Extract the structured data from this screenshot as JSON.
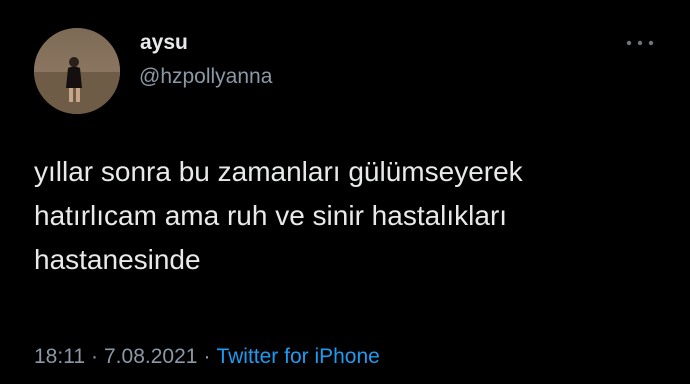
{
  "user": {
    "display_name": "aysu",
    "handle": "@hzpollyanna"
  },
  "tweet": {
    "lines": [
      "yıllar sonra bu zamanları gülümseyerek",
      "hatırlıcam ama ruh ve sinir hastalıkları",
      "hastanesinde"
    ]
  },
  "meta": {
    "time": "18:11",
    "separator": "·",
    "date": "7.08.2021",
    "source": "Twitter for iPhone"
  },
  "icons": {
    "avatar": "profile-photo",
    "more": "more-dots-icon"
  },
  "colors": {
    "background": "#000000",
    "text": "#e7e9ea",
    "secondary": "#8b98a5",
    "link": "#1d9bf0"
  }
}
